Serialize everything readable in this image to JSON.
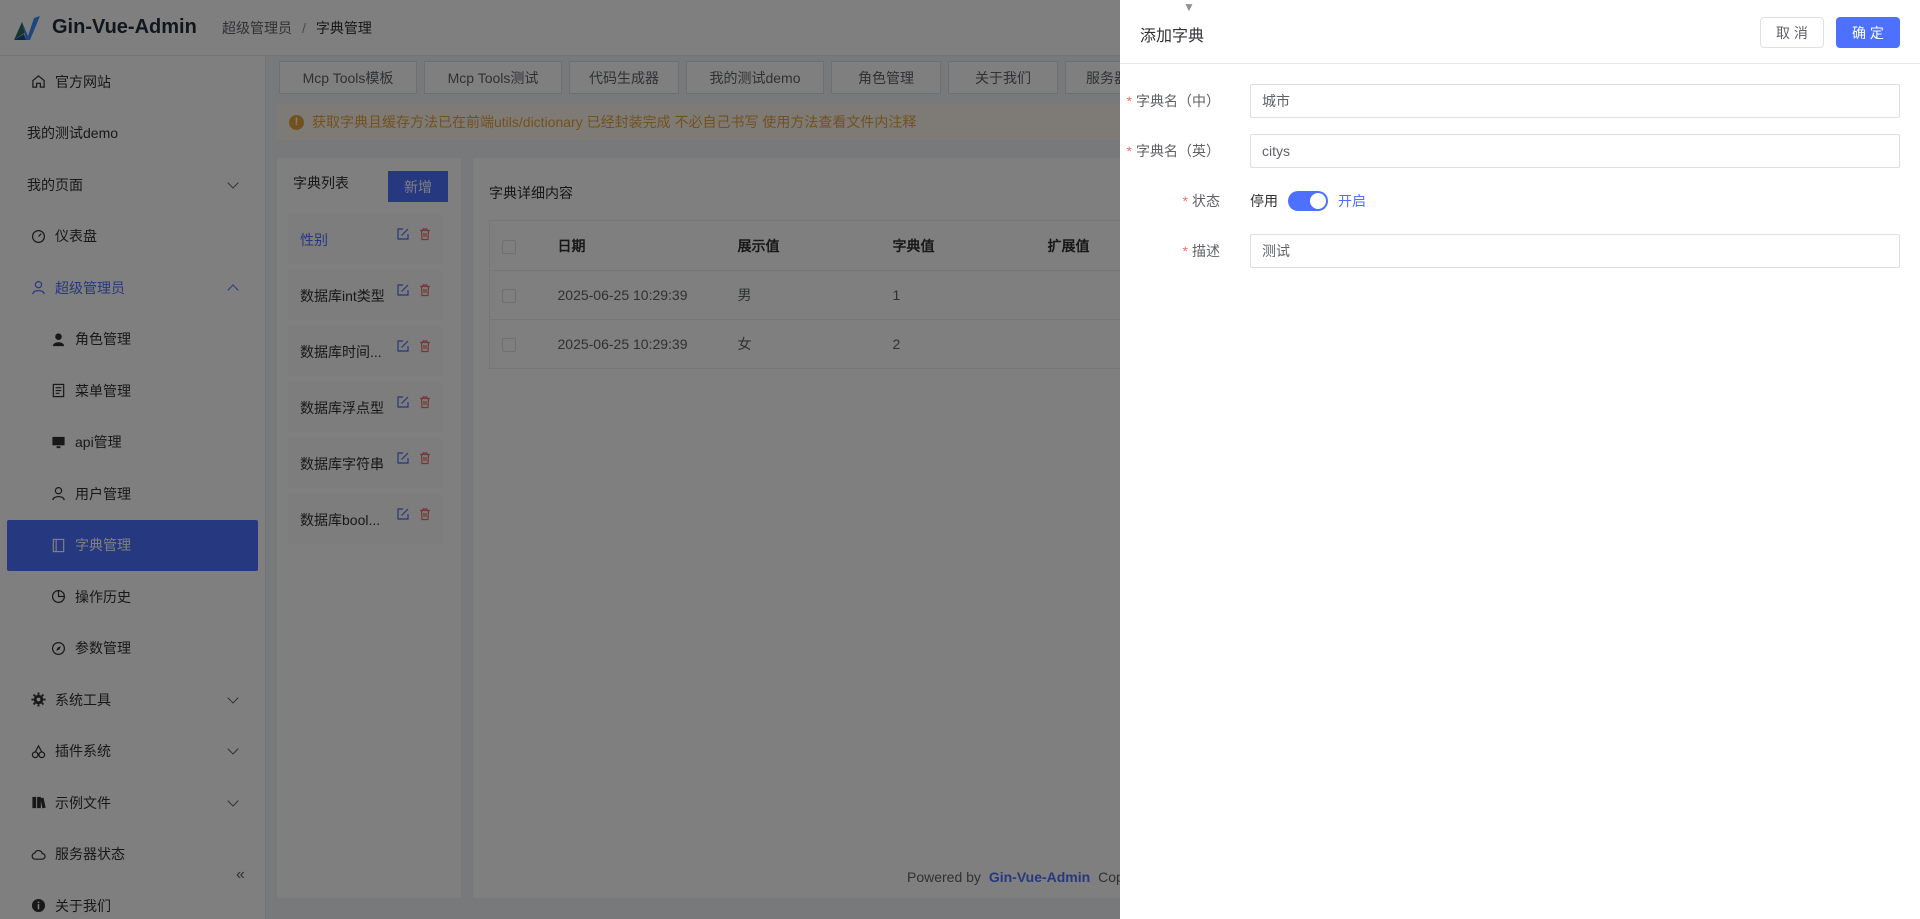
{
  "app": {
    "title": "Gin-Vue-Admin"
  },
  "breadcrumb": {
    "parent": "超级管理员",
    "separator": "/",
    "current": "字典管理"
  },
  "sidebar": {
    "items": [
      {
        "label": "官方网站",
        "icon": "home-icon"
      },
      {
        "label": "我的测试demo"
      },
      {
        "label": "我的页面",
        "expandable": true
      },
      {
        "label": "仪表盘",
        "icon": "dashboard-icon"
      },
      {
        "label": "超级管理员",
        "icon": "user-icon",
        "expanded": true
      },
      {
        "label": "角色管理",
        "icon": "avatar-icon"
      },
      {
        "label": "菜单管理",
        "icon": "document-icon"
      },
      {
        "label": "api管理",
        "icon": "monitor-icon"
      },
      {
        "label": "用户管理",
        "icon": "user-icon"
      },
      {
        "label": "字典管理",
        "icon": "notebook-icon",
        "active": true
      },
      {
        "label": "操作历史",
        "icon": "pie-chart-icon"
      },
      {
        "label": "参数管理",
        "icon": "compass-icon"
      },
      {
        "label": "系统工具",
        "icon": "gear-icon",
        "expandable": true
      },
      {
        "label": "插件系统",
        "icon": "cherry-icon",
        "expandable": true
      },
      {
        "label": "示例文件",
        "icon": "files-icon",
        "expandable": true
      },
      {
        "label": "服务器状态",
        "icon": "cloud-icon"
      },
      {
        "label": "关于我们",
        "icon": "info-icon"
      }
    ],
    "collapse_glyph": "«"
  },
  "tabs": [
    "Mcp Tools模板",
    "Mcp Tools测试",
    "代码生成器",
    "我的测试demo",
    "角色管理",
    "关于我们",
    "服务器"
  ],
  "notice": {
    "text": "获取字典且缓存方法已在前端utils/dictionary 已经封装完成 不必自己书写 使用方法查看文件内注释"
  },
  "dict_list": {
    "title": "字典列表",
    "add_label": "新增",
    "items": [
      "性别",
      "数据库int类型",
      "数据库时间...",
      "数据库浮点型",
      "数据库字符串",
      "数据库bool..."
    ]
  },
  "detail": {
    "title": "字典详细内容",
    "columns": [
      "日期",
      "展示值",
      "字典值",
      "扩展值"
    ],
    "rows": [
      [
        "2025-06-25 10:29:39",
        "男",
        "1",
        ""
      ],
      [
        "2025-06-25 10:29:39",
        "女",
        "2",
        ""
      ]
    ]
  },
  "footer": {
    "prefix": "Powered by",
    "brand": "Gin-Vue-Admin",
    "suffix": "Cop"
  },
  "drawer": {
    "title": "添加字典",
    "cancel_label": "取 消",
    "ok_label": "确 定",
    "form": {
      "name_cn": {
        "label": "字典名（中）",
        "value": "城市"
      },
      "name_en": {
        "label": "字典名（英）",
        "value": "citys"
      },
      "status": {
        "label": "状态",
        "off_label": "停用",
        "on_label": "开启",
        "enabled": true
      },
      "desc": {
        "label": "描述",
        "value": "测试"
      },
      "required_mark": "*"
    }
  },
  "colors": {
    "primary": "#4d70ff",
    "danger": "#f56c6c",
    "warning": "#e6a23c"
  }
}
